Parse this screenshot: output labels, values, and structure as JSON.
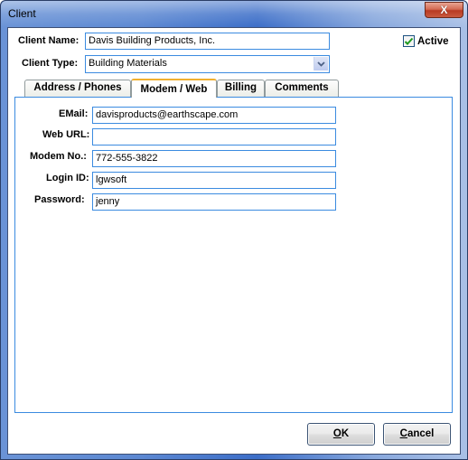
{
  "window": {
    "title": "Client",
    "close_label": "X"
  },
  "header": {
    "client_name_label": "Client Name:",
    "client_name_value": "Davis Building Products, Inc.",
    "client_type_label": "Client Type:",
    "client_type_value": "Building Materials",
    "active_label": "Active",
    "active_checked": true
  },
  "tabs": [
    {
      "label": "Address / Phones",
      "selected": false
    },
    {
      "label": "Modem / Web",
      "selected": true
    },
    {
      "label": "Billing",
      "selected": false
    },
    {
      "label": "Comments",
      "selected": false
    }
  ],
  "modem_web": {
    "email_label": "EMail:",
    "email_value": "davisproducts@earthscape.com",
    "web_url_label": "Web URL:",
    "web_url_value": "",
    "modem_no_label": "Modem No.:",
    "modem_no_value": "772-555-3822",
    "login_id_label": "Login ID:",
    "login_id_value": "lgwsoft",
    "password_label": "Password:",
    "password_value": "jenny"
  },
  "buttons": {
    "ok_label": "OK",
    "ok_accel": "O",
    "ok_rest": "K",
    "cancel_label": "Cancel",
    "cancel_accel": "C",
    "cancel_rest": "ancel"
  },
  "colors": {
    "field_border": "#3b8be0",
    "check_mark": "#1e9a1e",
    "selected_tab_accent": "#f0b030"
  }
}
